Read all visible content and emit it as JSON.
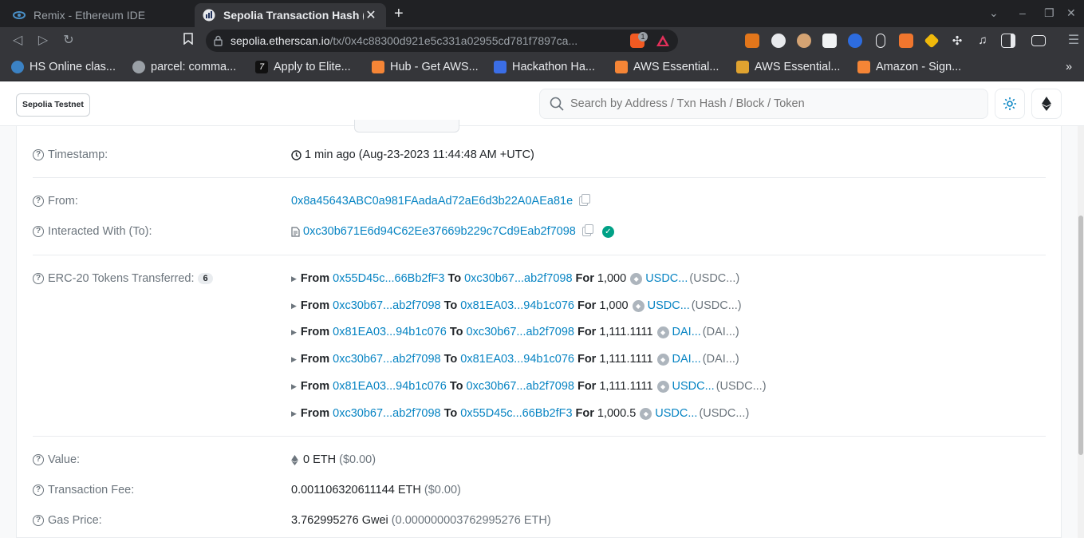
{
  "browser": {
    "tabs": [
      {
        "title": "Remix - Ethereum IDE",
        "active": false
      },
      {
        "title": "Sepolia Transaction Hash (",
        "active": true
      }
    ],
    "url_domain": "sepolia.etherscan.io",
    "url_path": "/tx/0x4c88300d921e5c331a02955cd781f7897ca...",
    "ext_badge": "1",
    "bookmarks": [
      {
        "label": "HS Online clas...",
        "color": "#3b82c4"
      },
      {
        "label": "parcel: comma...",
        "color": "#9aa0a6"
      },
      {
        "label": "Apply to Elite...",
        "color": "#1a1a1a"
      },
      {
        "label": "Hub - Get AWS...",
        "color": "#f58536"
      },
      {
        "label": "Hackathon Ha...",
        "color": "#3b6ee6"
      },
      {
        "label": "AWS Essential...",
        "color": "#f58536"
      },
      {
        "label": "AWS Essential...",
        "color": "#e0a330"
      },
      {
        "label": "Amazon - Sign...",
        "color": "#f58536"
      }
    ]
  },
  "header": {
    "network_badge": "Sepolia Testnet",
    "search_placeholder": "Search by Address / Txn Hash / Block / Token"
  },
  "tx": {
    "timestamp_label": "Timestamp:",
    "timestamp_value": "1 min ago (Aug-23-2023 11:44:48 AM +UTC)",
    "from_label": "From:",
    "from_value": "0x8a45643ABC0a981FAadaAd72aE6d3b22A0AEa81e",
    "to_label": "Interacted With (To):",
    "to_value": "0xc30b671E6d94C62Ee37669b229c7Cd9Eab2f7098",
    "erc20_label": "ERC-20 Tokens Transferred:",
    "erc20_count": "6",
    "transfers": [
      {
        "from": "0x55D45c...66Bb2fF3",
        "to": "0xc30b67...ab2f7098",
        "amount": "1,000",
        "token": "USDC...",
        "symbol": "(USDC...)"
      },
      {
        "from": "0xc30b67...ab2f7098",
        "to": "0x81EA03...94b1c076",
        "amount": "1,000",
        "token": "USDC...",
        "symbol": "(USDC...)"
      },
      {
        "from": "0x81EA03...94b1c076",
        "to": "0xc30b67...ab2f7098",
        "amount": "1,111.1111",
        "token": "DAI...",
        "symbol": "(DAI...)"
      },
      {
        "from": "0xc30b67...ab2f7098",
        "to": "0x81EA03...94b1c076",
        "amount": "1,111.1111",
        "token": "DAI...",
        "symbol": "(DAI...)"
      },
      {
        "from": "0x81EA03...94b1c076",
        "to": "0xc30b67...ab2f7098",
        "amount": "1,111.1111",
        "token": "USDC...",
        "symbol": "(USDC...)"
      },
      {
        "from": "0xc30b67...ab2f7098",
        "to": "0x55D45c...66Bb2fF3",
        "amount": "1,000.5",
        "token": "USDC...",
        "symbol": "(USDC...)"
      }
    ],
    "from_word": "From",
    "to_word": "To",
    "for_word": "For",
    "value_label": "Value:",
    "value_eth": "0 ETH",
    "value_usd": "($0.00)",
    "fee_label": "Transaction Fee:",
    "fee_eth": "0.001106320611144 ETH",
    "fee_usd": "($0.00)",
    "gas_label": "Gas Price:",
    "gas_gwei": "3.762995276 Gwei",
    "gas_eth": "(0.000000003762995276 ETH)"
  }
}
